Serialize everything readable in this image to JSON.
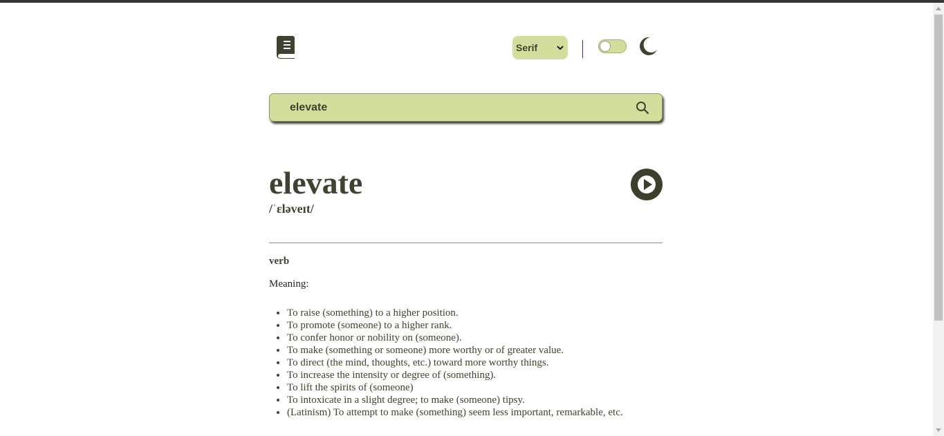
{
  "header": {
    "logo_icon": "book-icon",
    "font_select": {
      "value": "Serif"
    },
    "theme_toggle": {
      "state": "off"
    },
    "theme_icon": "moon-icon"
  },
  "search": {
    "value": "elevate",
    "icon": "search-icon"
  },
  "entry": {
    "word": "elevate",
    "phonetic": "/ˈɛləveɪt/",
    "play_icon": "play-icon",
    "part_of_speech": "verb",
    "meaning_label": "Meaning:",
    "definitions": [
      "To raise (something) to a higher position.",
      "To promote (someone) to a higher rank.",
      "To confer honor or nobility on (someone).",
      "To make (something or someone) more worthy or of greater value.",
      "To direct (the mind, thoughts, etc.) toward more worthy things.",
      "To increase the intensity or degree of (something).",
      "To lift the spirits of (someone)",
      "To intoxicate in a slight degree; to make (someone) tipsy.",
      "(Latinism) To attempt to make (something) seem less important, remarkable, etc."
    ]
  },
  "colors": {
    "accent": "#d4de9c",
    "text_dark": "#3f4230",
    "button_dark": "#3c3f2c"
  }
}
